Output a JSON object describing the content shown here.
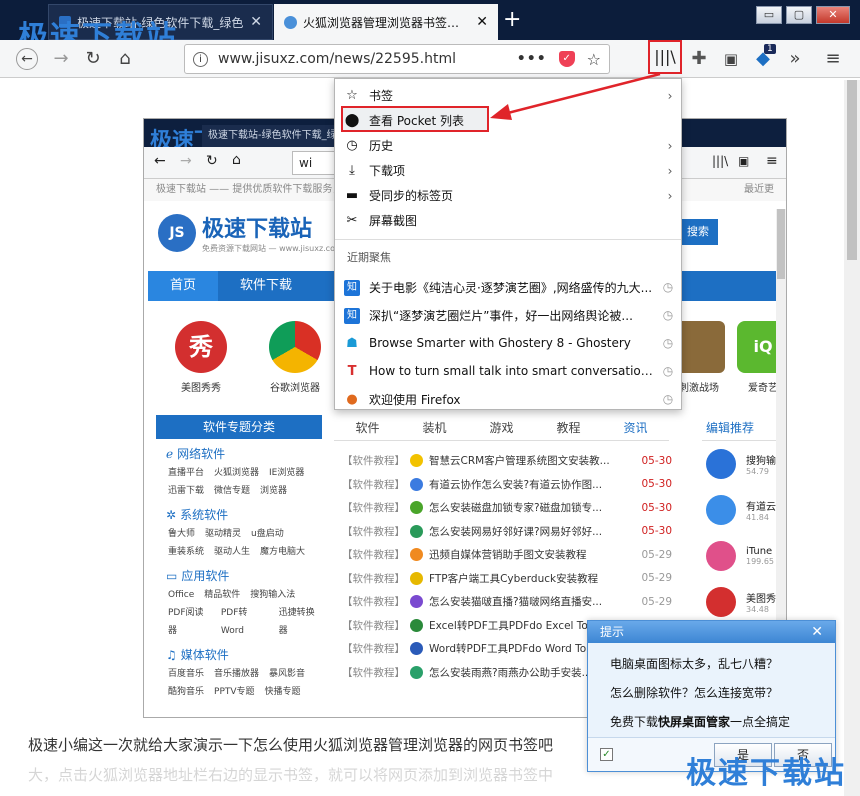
{
  "browser": {
    "tabs": [
      {
        "title": "极速下载站-绿色软件下载_绿色"
      },
      {
        "title": "火狐浏览器管理浏览器书签教程"
      }
    ],
    "url": "www.jisuxz.com/news/22595.html",
    "badge_count": "1",
    "window_buttons": {
      "minimize": "▭",
      "maximize": "▢",
      "close": "✕"
    }
  },
  "watermark": "极速下载站",
  "library_menu": {
    "items": [
      {
        "icon": "star-icon",
        "glyph": "☆",
        "label": "书签",
        "has_submenu": true
      },
      {
        "icon": "pocket-icon",
        "glyph": "⬤",
        "label": "查看 Pocket 列表",
        "has_submenu": false
      },
      {
        "icon": "history-icon",
        "glyph": "◷",
        "label": "历史",
        "has_submenu": true
      },
      {
        "icon": "download-icon",
        "glyph": "⤓",
        "label": "下载项",
        "has_submenu": true
      },
      {
        "icon": "synced-tabs-icon",
        "glyph": "▬",
        "label": "受同步的标签页",
        "has_submenu": true
      },
      {
        "icon": "screenshot-icon",
        "glyph": "✂",
        "label": "屏幕截图",
        "has_submenu": false
      }
    ],
    "section_title": "近期聚焦",
    "recent": [
      {
        "icon": "zhihu-icon",
        "label": "关于电影《纯洁心灵·逐梦演艺圈》,网络盛传的九大..."
      },
      {
        "icon": "zhihu-icon",
        "label": "深扒“逐梦演艺圈烂片”事件，好一出网络舆论被..."
      },
      {
        "icon": "ghostery-icon",
        "label": "Browse Smarter with Ghostery 8 - Ghostery"
      },
      {
        "icon": "t-icon",
        "label": "How to turn small talk into smart conversation |"
      },
      {
        "icon": "firefox-icon",
        "label": "欢迎使用 Firefox"
      }
    ]
  },
  "inner_page": {
    "tab_title": "极速下载站-绿色软件下载_绿",
    "url_prefix": "wi",
    "strip": "极速下载站 —— 提供优质软件下载服务，最",
    "strip_right": "最近更",
    "site_name": "极速下载站",
    "site_sub": "免费资源下载网站 — www.jisuxz.com",
    "logo_text": "JS",
    "search_btn": "搜索",
    "nav": [
      "首页",
      "软件下载",
      "软"
    ],
    "apps": [
      {
        "name": "美图秀秀",
        "color": "#d32f2f"
      },
      {
        "name": "谷歌浏览器",
        "color": "#2e9b44"
      },
      {
        "name": "刺激战场",
        "color": "#8a6a3a"
      },
      {
        "name": "爱奇艺",
        "color": "#5bb82f"
      }
    ],
    "left_header": "软件专题分类",
    "categories": [
      {
        "name": "网络软件",
        "subs": [
          [
            "直播平台",
            "火狐浏览器",
            "IE浏览器"
          ],
          [
            "迅雷下载",
            "微信专题",
            "浏览器"
          ]
        ]
      },
      {
        "name": "系统软件",
        "subs": [
          [
            "鲁大师",
            "驱动精灵",
            "u盘启动"
          ],
          [
            "重装系统",
            "驱动人生",
            "魔方电脑大"
          ]
        ]
      },
      {
        "name": "应用软件",
        "subs": [
          [
            "Office",
            "精品软件",
            "搜狗输入法"
          ],
          [
            "PDF阅读器",
            "PDF转Word",
            "迅捷转换器"
          ]
        ]
      },
      {
        "name": "媒体软件",
        "subs": [
          [
            "百度音乐",
            "音乐播放器",
            "暴风影音"
          ],
          [
            "酷狗音乐",
            "PPTV专题",
            "快播专题"
          ]
        ]
      }
    ],
    "content_tabs": [
      "软件",
      "装机",
      "游戏",
      "教程",
      "资讯"
    ],
    "news": [
      {
        "tag": "【软件教程】",
        "title": "智慧云CRM客户管理系统图文安装教...",
        "date": "05-30",
        "red": true,
        "color": "#f2c200"
      },
      {
        "tag": "【软件教程】",
        "title": "有道云协作怎么安装?有道云协作图...",
        "date": "05-30",
        "red": true,
        "color": "#3b7be0"
      },
      {
        "tag": "【软件教程】",
        "title": "怎么安装磁盘加锁专家?磁盘加锁专...",
        "date": "05-30",
        "red": true,
        "color": "#4aa52a"
      },
      {
        "tag": "【软件教程】",
        "title": "怎么安装网易好邻好课?网易好邻好...",
        "date": "05-30",
        "red": true,
        "color": "#2a9a5a"
      },
      {
        "tag": "【软件教程】",
        "title": "迅频自媒体营销助手图文安装教程",
        "date": "05-29",
        "red": false,
        "color": "#f08a20"
      },
      {
        "tag": "【软件教程】",
        "title": "FTP客户端工具Cyberduck安装教程",
        "date": "05-29",
        "red": false,
        "color": "#e6b800"
      },
      {
        "tag": "【软件教程】",
        "title": "怎么安装猫啵直播?猫啵网络直播安...",
        "date": "05-29",
        "red": false,
        "color": "#7a4ad0"
      },
      {
        "tag": "【软件教程】",
        "title": "Excel转PDF工具PDFdo Excel To P...",
        "date": "05-29",
        "red": false,
        "color": "#2a8a3a"
      },
      {
        "tag": "【软件教程】",
        "title": "Word转PDF工具PDFdo Word To PDF",
        "date": "05-29",
        "red": false,
        "color": "#2a5ab8"
      },
      {
        "tag": "【软件教程】",
        "title": "怎么安装雨燕?雨燕办公助手安装...",
        "date": "05-29",
        "red": false,
        "color": "#2aa06a"
      }
    ],
    "right_header": "编辑推荐",
    "recommend": [
      {
        "name": "搜狗输",
        "size": "54.79",
        "color": "#2a72d8"
      },
      {
        "name": "有道云",
        "size": "41.84",
        "color": "#3b8ee8"
      },
      {
        "name": "iTune",
        "size": "199.65",
        "color": "#e0508a"
      },
      {
        "name": "美图秀",
        "size": "34.48",
        "color": "#d32f2f"
      }
    ]
  },
  "page_text": {
    "line1": "极速小编这一次就给大家演示一下怎么使用火狐浏览器管理浏览器的网页书签吧",
    "line2": "大，点击火狐浏览器地址栏右边的显示书签，就可以将网页添加到浏览器书签中"
  },
  "popup": {
    "title": "提示",
    "lines": [
      "电脑桌面图标太多，乱七八糟？",
      "怎么删除软件？怎么连接宽带？"
    ],
    "line3_prefix": "免费下载",
    "line3_bold": "快屏桌面管家",
    "line3_suffix": "一点全搞定",
    "yes": "是",
    "no": "否",
    "checkbox_checked": true
  },
  "colors": {
    "accent": "#1d6fc3",
    "highlight_red": "#e0242a",
    "titlebar": "#0c1d3b"
  }
}
